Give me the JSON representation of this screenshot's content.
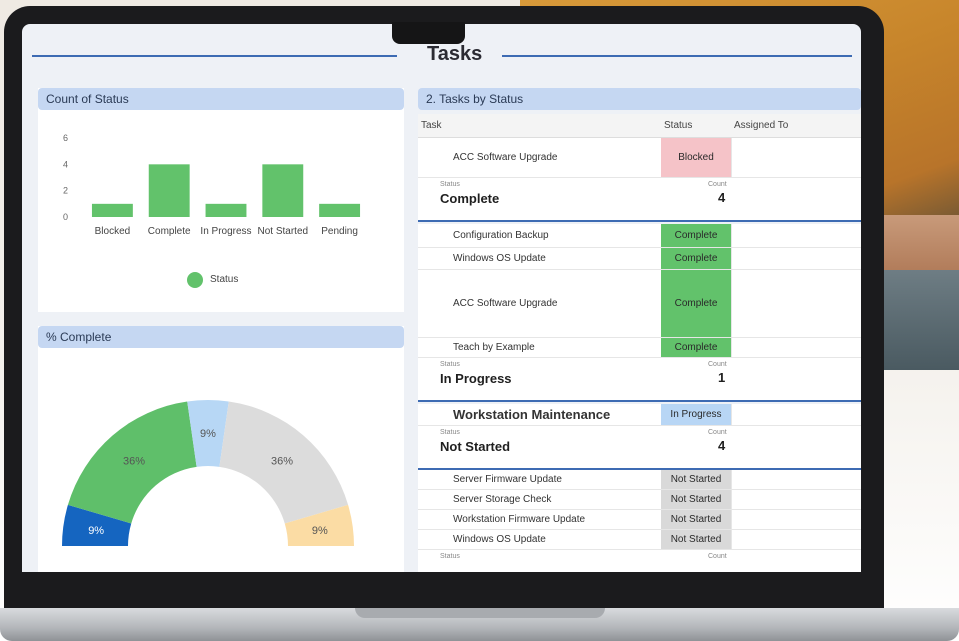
{
  "page_title": "Tasks",
  "count_panel": {
    "title": "Count of Status",
    "legend": "Status",
    "colors": {
      "bar": "#62c26b"
    }
  },
  "chart_data": {
    "type": "bar",
    "categories": [
      "Blocked",
      "Complete",
      "In Progress",
      "Not Started",
      "Pending"
    ],
    "values": [
      1,
      4,
      1,
      4,
      1
    ],
    "ylim": [
      0,
      6
    ],
    "yticks": [
      0,
      2,
      4,
      6
    ],
    "legend": "Status",
    "legend_position": "bottom-center"
  },
  "pct_panel": {
    "title": "% Complete",
    "slices": [
      {
        "label": "9%",
        "value": 9,
        "color": "#1565c0"
      },
      {
        "label": "36%",
        "value": 36,
        "color": "#5fbf6a"
      },
      {
        "label": "9%",
        "value": 9,
        "color": "#b7d7f5"
      },
      {
        "label": "36%",
        "value": 36,
        "color": "#dcdcdc"
      },
      {
        "label": "9%",
        "value": 9,
        "color": "#fbdca4"
      }
    ]
  },
  "tasks_panel": {
    "title": "2. Tasks by Status",
    "columns": {
      "task": "Task",
      "status": "Status",
      "assigned": "Assigned To"
    },
    "group_status_label": "Status",
    "group_count_label": "Count",
    "colors": {
      "blocked": "#f5c3c8",
      "complete": "#62c26b",
      "in_progress": "#b8d6f5",
      "not_started": "#d9d9d9"
    },
    "top_row": {
      "task": "ACC Software Upgrade",
      "status": "Blocked"
    },
    "groups": [
      {
        "name": "Complete",
        "count": "4",
        "rows": [
          {
            "task": "Configuration Backup",
            "status": "Complete"
          },
          {
            "task": "Windows OS Update",
            "status": "Complete"
          },
          {
            "task": "ACC Software Upgrade",
            "status": "Complete"
          },
          {
            "task": "Teach by Example",
            "status": "Complete"
          }
        ]
      },
      {
        "name": "In Progress",
        "count": "1",
        "rows": [
          {
            "task": "Workstation Maintenance",
            "status": "In Progress"
          }
        ]
      },
      {
        "name": "Not Started",
        "count": "4",
        "rows": [
          {
            "task": "Server Firmware Update",
            "status": "Not Started"
          },
          {
            "task": "Server Storage Check",
            "status": "Not Started"
          },
          {
            "task": "Workstation Firmware Update",
            "status": "Not Started"
          },
          {
            "task": "Windows OS Update",
            "status": "Not Started"
          }
        ]
      }
    ]
  }
}
